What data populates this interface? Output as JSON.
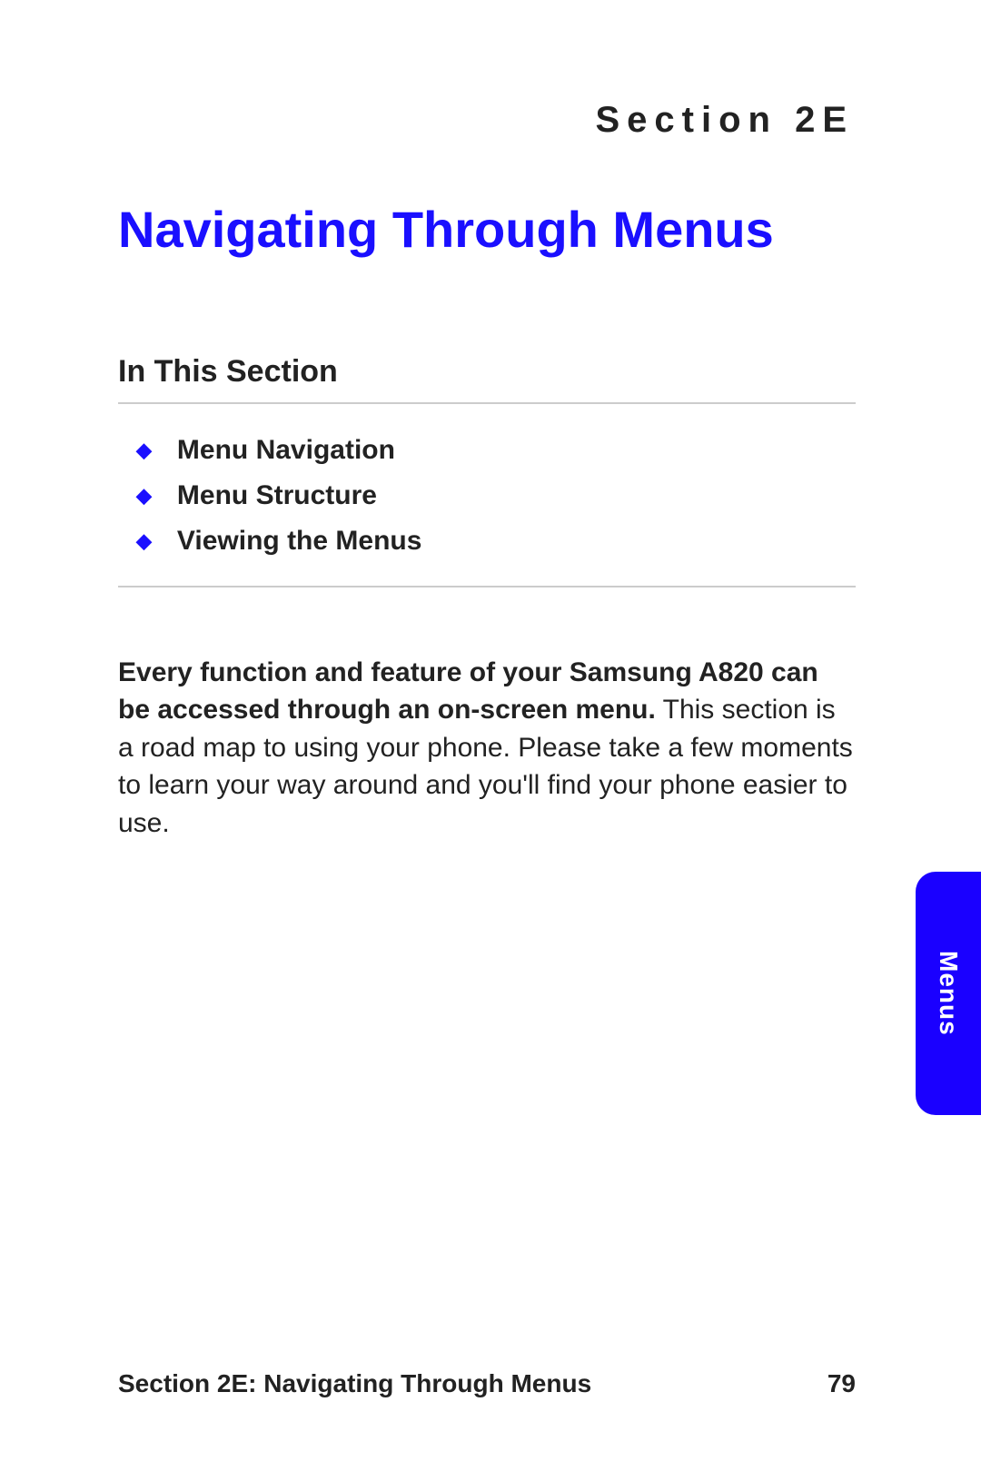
{
  "section_label": "Section 2E",
  "title": "Navigating Through Menus",
  "in_this_section": {
    "heading": "In This Section",
    "items": [
      "Menu Navigation",
      "Menu Structure",
      "Viewing the Menus"
    ]
  },
  "body": {
    "bold_intro": "Every function and feature of your Samsung A820 can be accessed through an on-screen menu.",
    "rest": " This section is a road map to using your phone. Please take a few moments to learn your way around and you'll find your phone easier to use."
  },
  "side_tab": "Menus",
  "footer": {
    "left": "Section 2E: Navigating Through Menus",
    "right": "79"
  }
}
